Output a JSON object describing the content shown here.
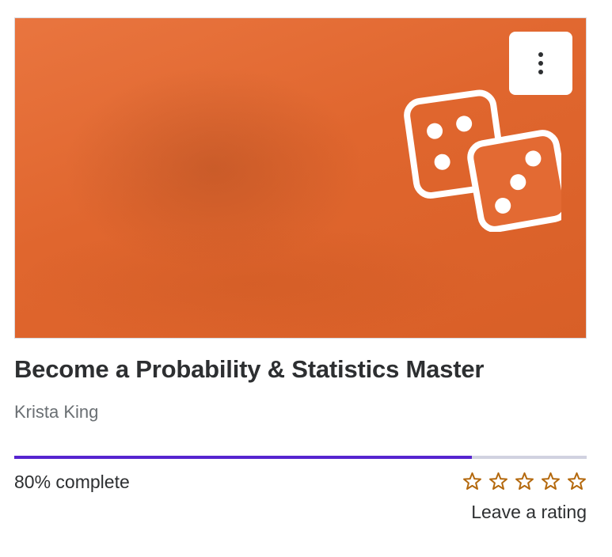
{
  "course": {
    "title": "Become a Probability & Statistics Master",
    "instructor": "Krista King",
    "progress_percent": 80,
    "progress_text": "80% complete",
    "rating": {
      "star_count": 5,
      "selected": 0,
      "cta": "Leave a rating"
    },
    "thumbnail": {
      "icon": "dice-icon"
    },
    "menu": {
      "icon": "more-vertical-icon"
    }
  },
  "colors": {
    "thumbnail_bg": "#e36a33",
    "title_text": "#2d2f31",
    "author_text": "#6a6f73",
    "progress_fill": "#5624d0",
    "progress_track": "#d1d2e0",
    "star": "#b4690e"
  }
}
